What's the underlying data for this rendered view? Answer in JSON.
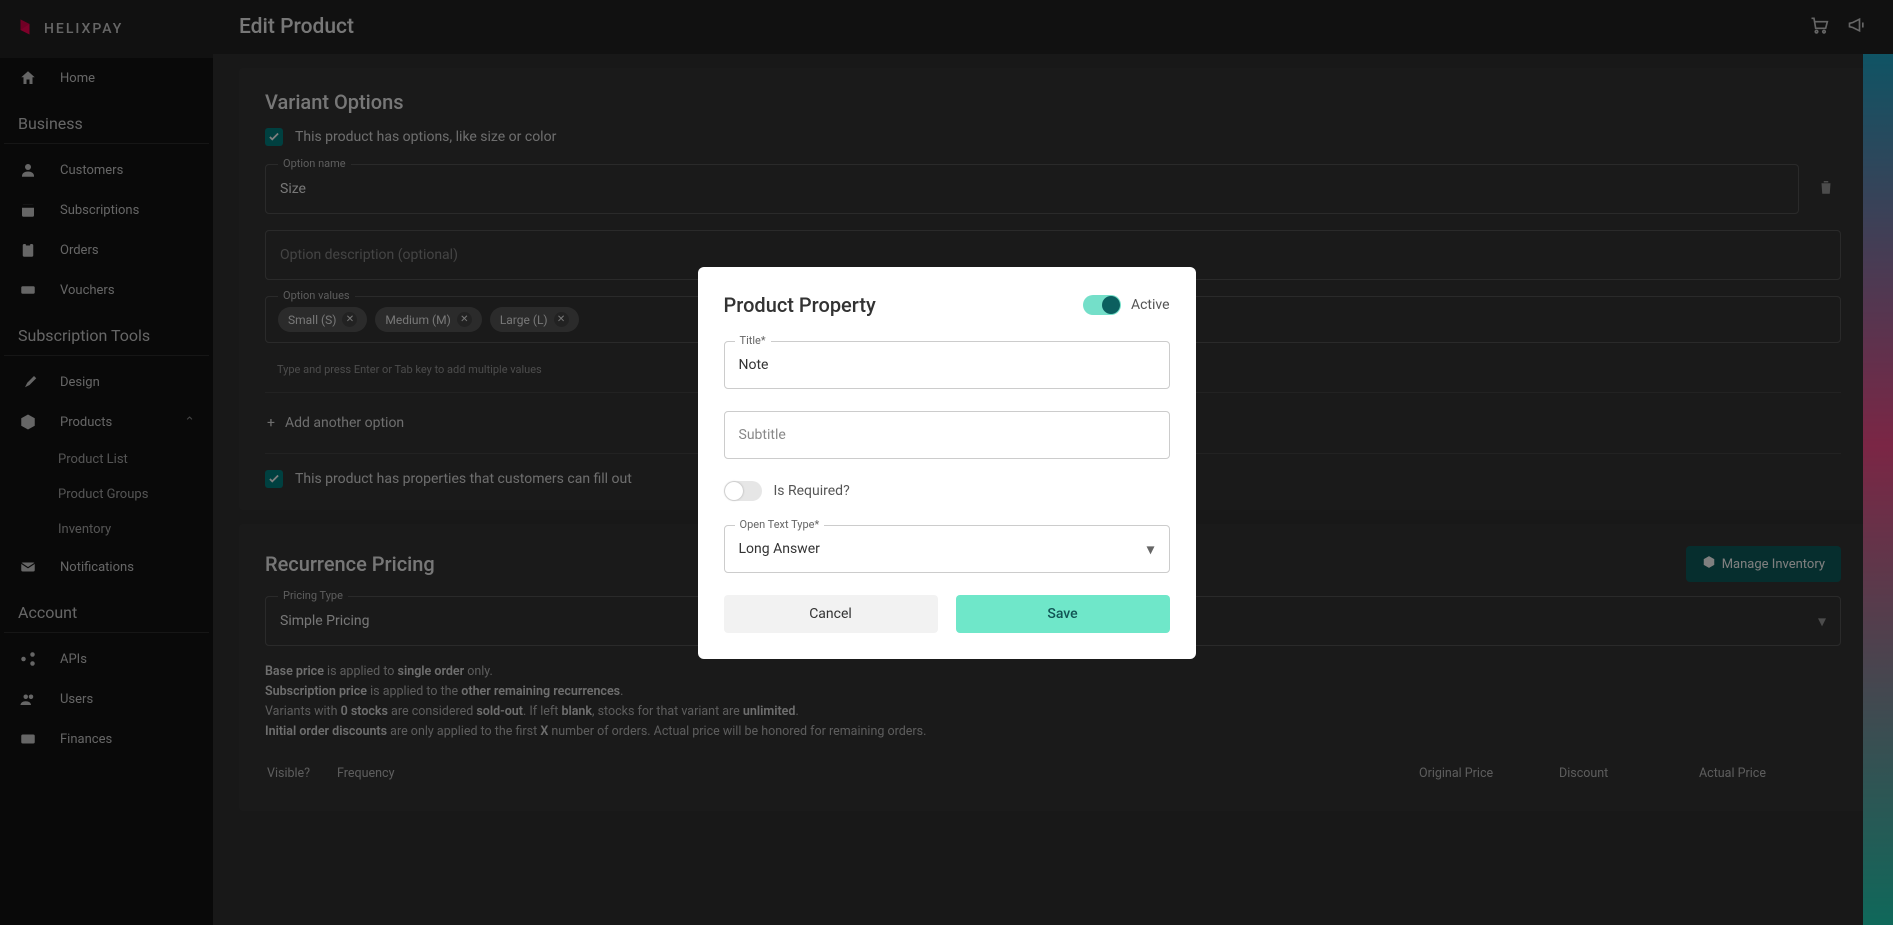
{
  "brand": "HELIXPAY",
  "header": {
    "title": "Edit Product"
  },
  "sidebar": {
    "home": "Home",
    "section_business": "Business",
    "customers": "Customers",
    "subscriptions": "Subscriptions",
    "orders": "Orders",
    "vouchers": "Vouchers",
    "section_tools": "Subscription Tools",
    "design": "Design",
    "products": "Products",
    "product_list": "Product List",
    "product_groups": "Product Groups",
    "inventory": "Inventory",
    "notifications": "Notifications",
    "section_account": "Account",
    "apis": "APIs",
    "users": "Users",
    "finances": "Finances"
  },
  "variant": {
    "title": "Variant Options",
    "check_options": "This product has options, like size or color",
    "option_name_label": "Option name",
    "option_name_value": "Size",
    "option_desc_placeholder": "Option description (optional)",
    "option_values_label": "Option values",
    "chips": [
      "Small (S)",
      "Medium (M)",
      "Large (L)"
    ],
    "hint": "Type and press Enter or Tab key to add multiple values",
    "add_option": "Add another option",
    "check_properties": "This product has properties that customers can fill out"
  },
  "pricing": {
    "title": "Recurrence Pricing",
    "manage_inventory": "Manage Inventory",
    "type_label": "Pricing Type",
    "type_value": "Simple Pricing",
    "notes": {
      "l1a": "Base price",
      "l1b": " is applied to ",
      "l1c": "single order",
      "l1d": " only.",
      "l2a": "Subscription price",
      "l2b": " is applied to the ",
      "l2c": "other remaining recurrences",
      "l3a": "Variants with ",
      "l3b": "0 stocks",
      "l3c": " are considered ",
      "l3d": "sold-out",
      "l3e": ". If left ",
      "l3f": "blank",
      "l3g": ", stocks for that variant are ",
      "l3h": "unlimited",
      "l4a": "Initial order discounts",
      "l4b": " are only applied to the first ",
      "l4c": "X",
      "l4d": " number of orders. Actual price will be honored for remaining orders."
    },
    "cols": {
      "visible": "Visible?",
      "frequency": "Frequency",
      "original": "Original Price",
      "discount": "Discount",
      "actual": "Actual Price"
    }
  },
  "modal": {
    "title": "Product Property",
    "active_label": "Active",
    "title_label": "Title*",
    "title_value": "Note",
    "subtitle_placeholder": "Subtitle",
    "required_label": "Is Required?",
    "open_text_label": "Open Text Type*",
    "open_text_value": "Long Answer",
    "cancel": "Cancel",
    "save": "Save"
  }
}
